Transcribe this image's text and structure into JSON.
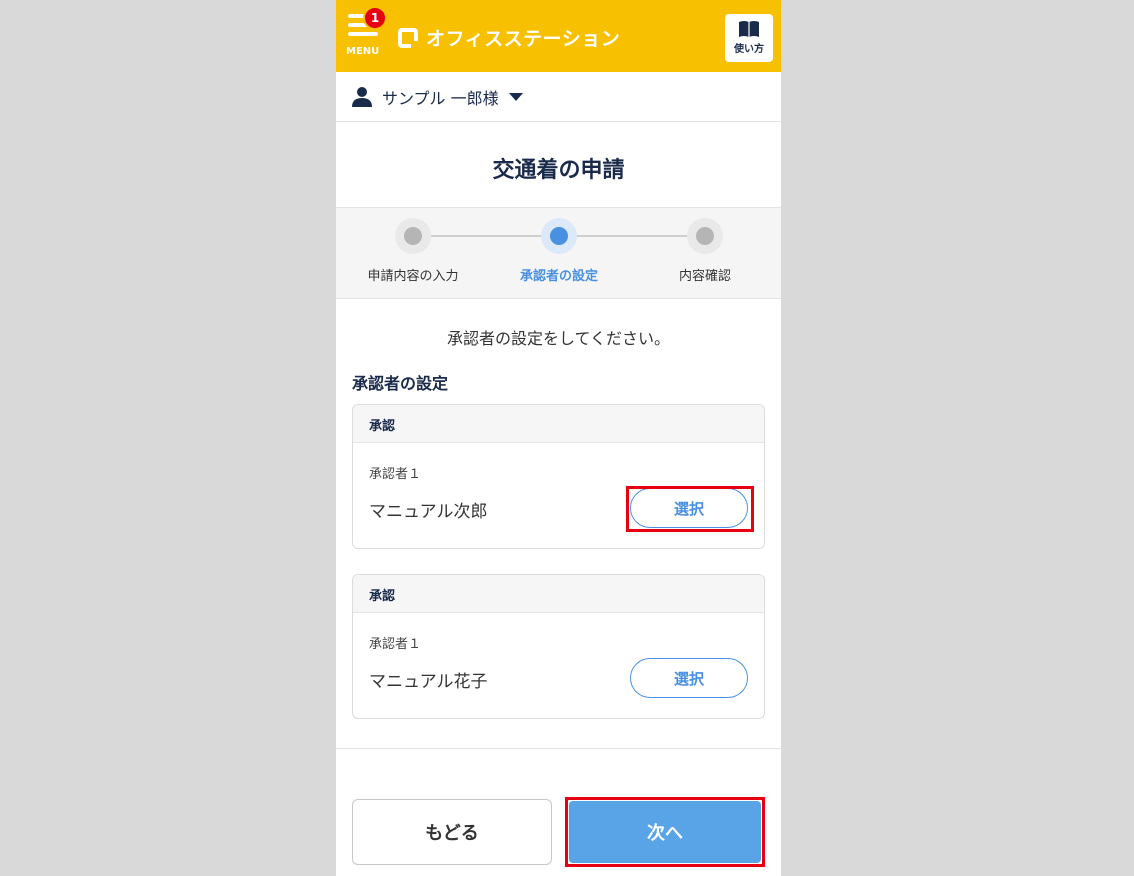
{
  "header": {
    "menu_label": "MENU",
    "notification_count": "1",
    "app_name": "オフィスステーション",
    "guide_label": "使い方",
    "brand_color": "#f7c000"
  },
  "user": {
    "name": "サンプル 一郎様"
  },
  "page": {
    "title": "交通着の申請"
  },
  "steps": [
    {
      "label": "申請内容の入力",
      "state": "done"
    },
    {
      "label": "承認者の設定",
      "state": "active"
    },
    {
      "label": "内容確認",
      "state": "pending"
    }
  ],
  "main": {
    "instruction": "承認者の設定をしてください。",
    "section_heading": "承認者の設定",
    "approval_cards": [
      {
        "header": "承認",
        "approver_label": "承認者１",
        "approver_name": "マニュアル次郎",
        "select_label": "選択",
        "highlighted": true
      },
      {
        "header": "承認",
        "approver_label": "承認者１",
        "approver_name": "マニュアル花子",
        "select_label": "選択",
        "highlighted": false
      }
    ]
  },
  "footer": {
    "back_label": "もどる",
    "next_label": "次へ"
  },
  "colors": {
    "accent_blue": "#4a90e2",
    "next_button": "#58a4e6",
    "highlight_red": "#e60012"
  }
}
